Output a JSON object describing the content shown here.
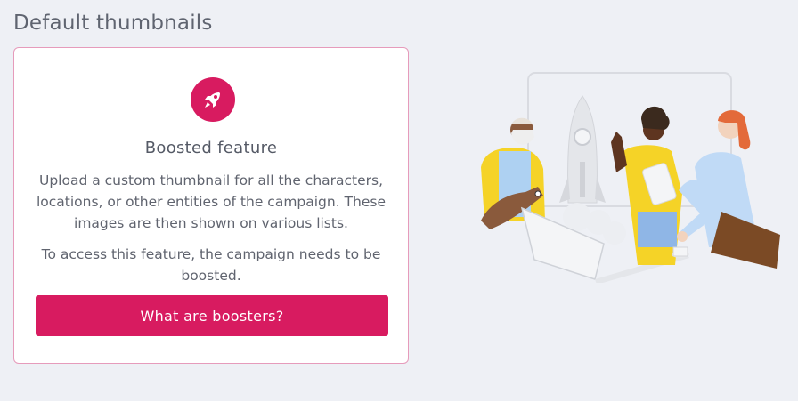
{
  "page": {
    "title": "Default thumbnails"
  },
  "feature_card": {
    "icon": "rocket-icon",
    "title": "Boosted feature",
    "description": "Upload a custom thumbnail for all the characters, locations, or other entities of the campaign. These images are then shown on various lists.",
    "access_note": "To access this feature, the campaign needs to be boosted.",
    "button_label": "What are boosters?"
  },
  "illustration": {
    "subject": "team-launching-rocket-illustration"
  },
  "colors": {
    "accent": "#d81b60",
    "background": "#eef0f5",
    "card_border": "#e69bbb"
  }
}
